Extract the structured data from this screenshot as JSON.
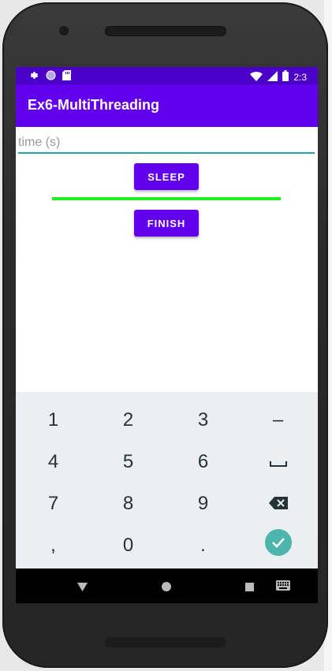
{
  "status_bar": {
    "time": "2:3",
    "left_icons": [
      "gear-icon",
      "circle-icon",
      "sd-card-icon"
    ],
    "right_icons": [
      "wifi-icon",
      "signal-icon",
      "battery-icon"
    ]
  },
  "app": {
    "title": "Ex6-MultiThreading"
  },
  "form": {
    "time_placeholder": "time (s)",
    "time_value": "",
    "sleep_label": "SLEEP",
    "finish_label": "FINISH",
    "progress": 1.0
  },
  "keyboard": {
    "rows": [
      [
        "1",
        "2",
        "3",
        "–"
      ],
      [
        "4",
        "5",
        "6",
        "␣"
      ],
      [
        "7",
        "8",
        "9",
        "⌫"
      ],
      [
        ",",
        "0",
        ".",
        "✓"
      ]
    ]
  },
  "nav": {
    "icons": [
      "back-icon",
      "home-icon",
      "recents-icon",
      "keyboard-switch-icon"
    ]
  },
  "colors": {
    "primary": "#6200ee",
    "status_bar": "#4a00c8",
    "progress": "#22ee22",
    "accent": "#26a6a6",
    "done_key": "#4db6ac"
  }
}
